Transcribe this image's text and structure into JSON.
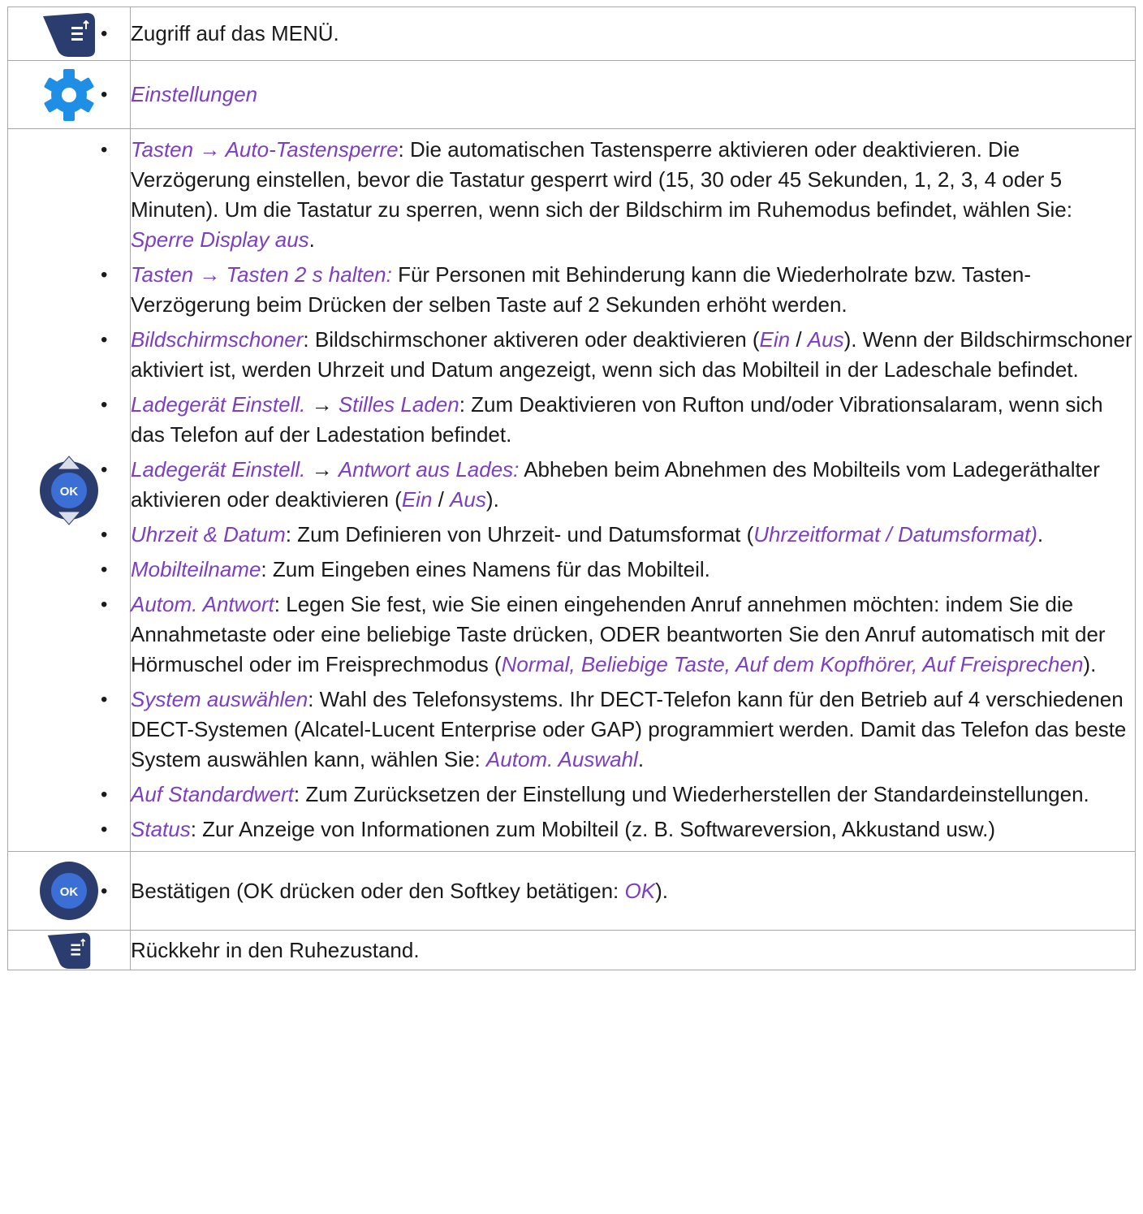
{
  "rows": {
    "menu": {
      "icon": "menu-key-icon",
      "text": "Zugriff auf das MENÜ."
    },
    "settings": {
      "icon": "gear-icon",
      "label": "Einstellungen",
      "color": "#7b3fc4"
    },
    "list": {
      "icon": "navigator-ok-icon",
      "items": [
        {
          "h1": "Tasten",
          "arrow": " → ",
          "h2": "Auto-Tastensperre",
          "t1": ": Die automatischen Tastensperre aktivieren oder deaktivieren. Die Verzögerung einstellen, bevor die Tastatur gesperrt wird (15, 30 oder 45 Sekunden, 1, 2, 3, 4 oder 5 Minuten). Um die Tastatur zu sperren, wenn sich der Bildschirm im Ruhemodus befindet, wählen Sie: ",
          "h3": "Sperre Display aus",
          "t2": "."
        },
        {
          "h1": "Tasten",
          "arrow": " → ",
          "h2": "Tasten 2 s halten:",
          "t1": " Für Personen mit Behinderung kann die Wiederholrate bzw. Tasten-Verzögerung beim Drücken der selben Taste auf 2 Sekunden erhöht werden."
        },
        {
          "h1": "Bildschirmschoner",
          "t1": ": Bildschirmschoner aktiveren oder deaktivieren (",
          "h2": "Ein",
          "t2": " / ",
          "h3": "Aus",
          "t3": "). Wenn der Bildschirmschoner aktiviert ist, werden Uhrzeit und Datum angezeigt, wenn sich das Mobilteil in der Ladeschale befindet."
        },
        {
          "h1": "Ladegerät Einstell.",
          "arrow": " → ",
          "h2": "Stilles Laden",
          "t1": ": Zum Deaktivieren von Rufton und/oder Vibrationsalaram, wenn sich das Telefon auf der Ladestation befindet."
        },
        {
          "h1": "Ladegerät Einstell.",
          "arrow": " → ",
          "h2": "Antwort aus Lades:",
          "t1": " Abheben beim Abnehmen des Mobilteils vom Ladegeräthalter aktivieren oder deaktivieren (",
          "h3": "Ein",
          "t2": " / ",
          "h4": "Aus",
          "t3": ")."
        },
        {
          "h1": "Uhrzeit & Datum",
          "t1": ": Zum Definieren von Uhrzeit- und Datumsformat (",
          "h2": "Uhrzeitformat / Datumsformat)",
          "t2": "."
        },
        {
          "h1": "Mobilteilname",
          "t1": ": Zum Eingeben eines Namens für das Mobilteil."
        },
        {
          "h1": "Autom. Antwort",
          "t1": ": Legen Sie fest, wie Sie einen eingehenden Anruf annehmen möchten: indem Sie die Annahmetaste oder eine beliebige Taste drücken, ODER beantworten Sie den Anruf automatisch mit der Hörmuschel oder im Freisprechmodus (",
          "h2": "Normal, Beliebige Taste, Auf dem Kopfhörer, Auf Freisprechen",
          "t2": ")."
        },
        {
          "h1": "System auswählen",
          "t1": ": Wahl des Telefonsystems. Ihr DECT-Telefon kann für den Betrieb auf 4 verschiedenen DECT-Systemen (Alcatel-Lucent Enterprise oder GAP) programmiert werden. Damit das Telefon das beste System auswählen kann, wählen Sie: ",
          "h2": "Autom. Auswahl",
          "t2": "."
        },
        {
          "h1": "Auf Standardwert",
          "t1": ": Zum Zurücksetzen der Einstellung und Wiederherstellen der Standardeinstellungen."
        },
        {
          "h1": "Status",
          "t1": ": Zur Anzeige von Informationen zum Mobilteil (z. B. Softwareversion, Akkustand usw.)"
        }
      ]
    },
    "ok": {
      "icon": "ok-button-icon",
      "t1": "Bestätigen (OK drücken oder den Softkey betätigen: ",
      "h1": "OK",
      "t2": ")."
    },
    "back": {
      "icon": "menu-key-icon",
      "text": "Rückkehr in den Ruhezustand."
    }
  },
  "icon_glyphs": {
    "ok_label": "OK"
  },
  "colors": {
    "highlight": "#7b3fc4",
    "key_dark": "#2b3d6e",
    "key_blue": "#3b6fd6",
    "gear_blue": "#1f8fe6"
  }
}
